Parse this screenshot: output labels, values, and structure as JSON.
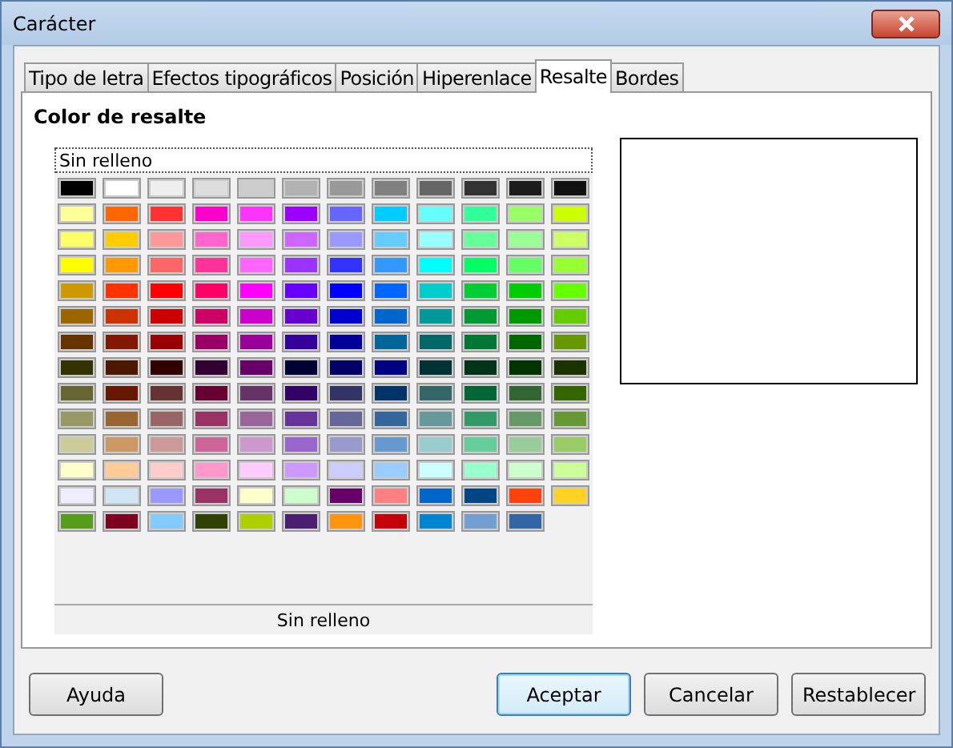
{
  "window": {
    "title": "Carácter"
  },
  "tabs": [
    {
      "label": "Tipo de letra",
      "selected": false
    },
    {
      "label": "Efectos tipográficos",
      "selected": false
    },
    {
      "label": "Posición",
      "selected": false
    },
    {
      "label": "Hiperenlace",
      "selected": false
    },
    {
      "label": "Resalte",
      "selected": true
    },
    {
      "label": "Bordes",
      "selected": false
    }
  ],
  "section_title": "Color de resalte",
  "palette": {
    "no_fill_button": "Sin relleno",
    "footer_label": "Sin relleno",
    "swatches": [
      {
        "color": "#000000"
      },
      {
        "color": "#ffffff"
      },
      {
        "color": "#eeeeee"
      },
      {
        "color": "#dddddd"
      },
      {
        "color": "#cccccc"
      },
      {
        "color": "#b2b2b2"
      },
      {
        "color": "#999999"
      },
      {
        "color": "#808080"
      },
      {
        "color": "#666666"
      },
      {
        "color": "#333333"
      },
      {
        "color": "#1c1c1c"
      },
      {
        "color": "#111111"
      },
      {
        "color": "#ffff99"
      },
      {
        "color": "#ff6600"
      },
      {
        "color": "#ff3333"
      },
      {
        "color": "#ff00cc"
      },
      {
        "color": "#ff33ff"
      },
      {
        "color": "#9900ff"
      },
      {
        "color": "#6666ff"
      },
      {
        "color": "#00ccff"
      },
      {
        "color": "#66ffff"
      },
      {
        "color": "#33ff99"
      },
      {
        "color": "#99ff66"
      },
      {
        "color": "#ccff00"
      },
      {
        "color": "#ffff66"
      },
      {
        "color": "#ffcc00"
      },
      {
        "color": "#ff9999"
      },
      {
        "color": "#ff66cc"
      },
      {
        "color": "#ff99ff"
      },
      {
        "color": "#cc66ff"
      },
      {
        "color": "#9999ff"
      },
      {
        "color": "#66ccff"
      },
      {
        "color": "#99ffff"
      },
      {
        "color": "#66ff99"
      },
      {
        "color": "#99ff99"
      },
      {
        "color": "#ccff66"
      },
      {
        "color": "#ffff00"
      },
      {
        "color": "#ff9900"
      },
      {
        "color": "#ff6666"
      },
      {
        "color": "#ff3399"
      },
      {
        "color": "#ff66ff"
      },
      {
        "color": "#9933ff"
      },
      {
        "color": "#3333ff"
      },
      {
        "color": "#3399ff"
      },
      {
        "color": "#00ffff"
      },
      {
        "color": "#00ff66"
      },
      {
        "color": "#66ff66"
      },
      {
        "color": "#99ff33"
      },
      {
        "color": "#cc9900"
      },
      {
        "color": "#ff3300"
      },
      {
        "color": "#ff0000"
      },
      {
        "color": "#ff0066"
      },
      {
        "color": "#ff00ff"
      },
      {
        "color": "#6600ff"
      },
      {
        "color": "#0000ff"
      },
      {
        "color": "#0066ff"
      },
      {
        "color": "#00cccc"
      },
      {
        "color": "#00cc33"
      },
      {
        "color": "#00cc00"
      },
      {
        "color": "#66ff00"
      },
      {
        "color": "#996600"
      },
      {
        "color": "#cc3300"
      },
      {
        "color": "#cc0000"
      },
      {
        "color": "#cc0066"
      },
      {
        "color": "#cc00cc"
      },
      {
        "color": "#6600cc"
      },
      {
        "color": "#0000cc"
      },
      {
        "color": "#0066cc"
      },
      {
        "color": "#009999"
      },
      {
        "color": "#009933"
      },
      {
        "color": "#009900"
      },
      {
        "color": "#66cc00"
      },
      {
        "color": "#663300"
      },
      {
        "color": "#801900"
      },
      {
        "color": "#990000"
      },
      {
        "color": "#990066"
      },
      {
        "color": "#990099"
      },
      {
        "color": "#330099"
      },
      {
        "color": "#000099"
      },
      {
        "color": "#006699"
      },
      {
        "color": "#006666"
      },
      {
        "color": "#007733"
      },
      {
        "color": "#006600"
      },
      {
        "color": "#669900"
      },
      {
        "color": "#333300"
      },
      {
        "color": "#4c1900"
      },
      {
        "color": "#330000"
      },
      {
        "color": "#330033"
      },
      {
        "color": "#660066"
      },
      {
        "color": "#000033"
      },
      {
        "color": "#000066"
      },
      {
        "color": "#000080"
      },
      {
        "color": "#003333"
      },
      {
        "color": "#003319"
      },
      {
        "color": "#003300"
      },
      {
        "color": "#1c3300"
      },
      {
        "color": "#666633"
      },
      {
        "color": "#661900"
      },
      {
        "color": "#663333"
      },
      {
        "color": "#660033"
      },
      {
        "color": "#663366"
      },
      {
        "color": "#330066"
      },
      {
        "color": "#333366"
      },
      {
        "color": "#003366"
      },
      {
        "color": "#336666"
      },
      {
        "color": "#006633"
      },
      {
        "color": "#336633"
      },
      {
        "color": "#336600"
      },
      {
        "color": "#999966"
      },
      {
        "color": "#996633"
      },
      {
        "color": "#996666"
      },
      {
        "color": "#993366"
      },
      {
        "color": "#996699"
      },
      {
        "color": "#663399"
      },
      {
        "color": "#666699"
      },
      {
        "color": "#336699"
      },
      {
        "color": "#669999"
      },
      {
        "color": "#339966"
      },
      {
        "color": "#669966"
      },
      {
        "color": "#669933"
      },
      {
        "color": "#cccc99"
      },
      {
        "color": "#cc9966"
      },
      {
        "color": "#cc9999"
      },
      {
        "color": "#cc6699"
      },
      {
        "color": "#cc99cc"
      },
      {
        "color": "#9966cc"
      },
      {
        "color": "#9999cc"
      },
      {
        "color": "#6699cc"
      },
      {
        "color": "#99cccc"
      },
      {
        "color": "#66cc99"
      },
      {
        "color": "#99cc99"
      },
      {
        "color": "#99cc66"
      },
      {
        "color": "#ffffcc"
      },
      {
        "color": "#ffcc99"
      },
      {
        "color": "#ffcccc"
      },
      {
        "color": "#ff99cc"
      },
      {
        "color": "#ffccff"
      },
      {
        "color": "#cc99ff"
      },
      {
        "color": "#ccccff"
      },
      {
        "color": "#99ccff"
      },
      {
        "color": "#ccffff"
      },
      {
        "color": "#99ffcc"
      },
      {
        "color": "#ccffcc"
      },
      {
        "color": "#ccff99"
      },
      {
        "color": "#eeeeff"
      },
      {
        "color": "#cfe7f5"
      },
      {
        "color": "#9999ff"
      },
      {
        "color": "#993366"
      },
      {
        "color": "#ffffcc"
      },
      {
        "color": "#ccffcc"
      },
      {
        "color": "#660066"
      },
      {
        "color": "#ff8080"
      },
      {
        "color": "#0066cc"
      },
      {
        "color": "#004586"
      },
      {
        "color": "#ff420e"
      },
      {
        "color": "#ffd320"
      },
      {
        "color": "#579d1c"
      },
      {
        "color": "#7e0021"
      },
      {
        "color": "#83caff"
      },
      {
        "color": "#314004"
      },
      {
        "color": "#aecf00"
      },
      {
        "color": "#4b1f6f"
      },
      {
        "color": "#ff950e"
      },
      {
        "color": "#c5000b"
      },
      {
        "color": "#0084d1"
      },
      {
        "color": "#729fcf"
      },
      {
        "color": "#3465a4"
      }
    ]
  },
  "buttons": [
    {
      "label": "Ayuda",
      "kind": "help",
      "default": false
    },
    {
      "label": "Aceptar",
      "kind": "action",
      "default": true
    },
    {
      "label": "Cancelar",
      "kind": "action",
      "default": false
    },
    {
      "label": "Restablecer",
      "kind": "action",
      "default": false
    }
  ]
}
